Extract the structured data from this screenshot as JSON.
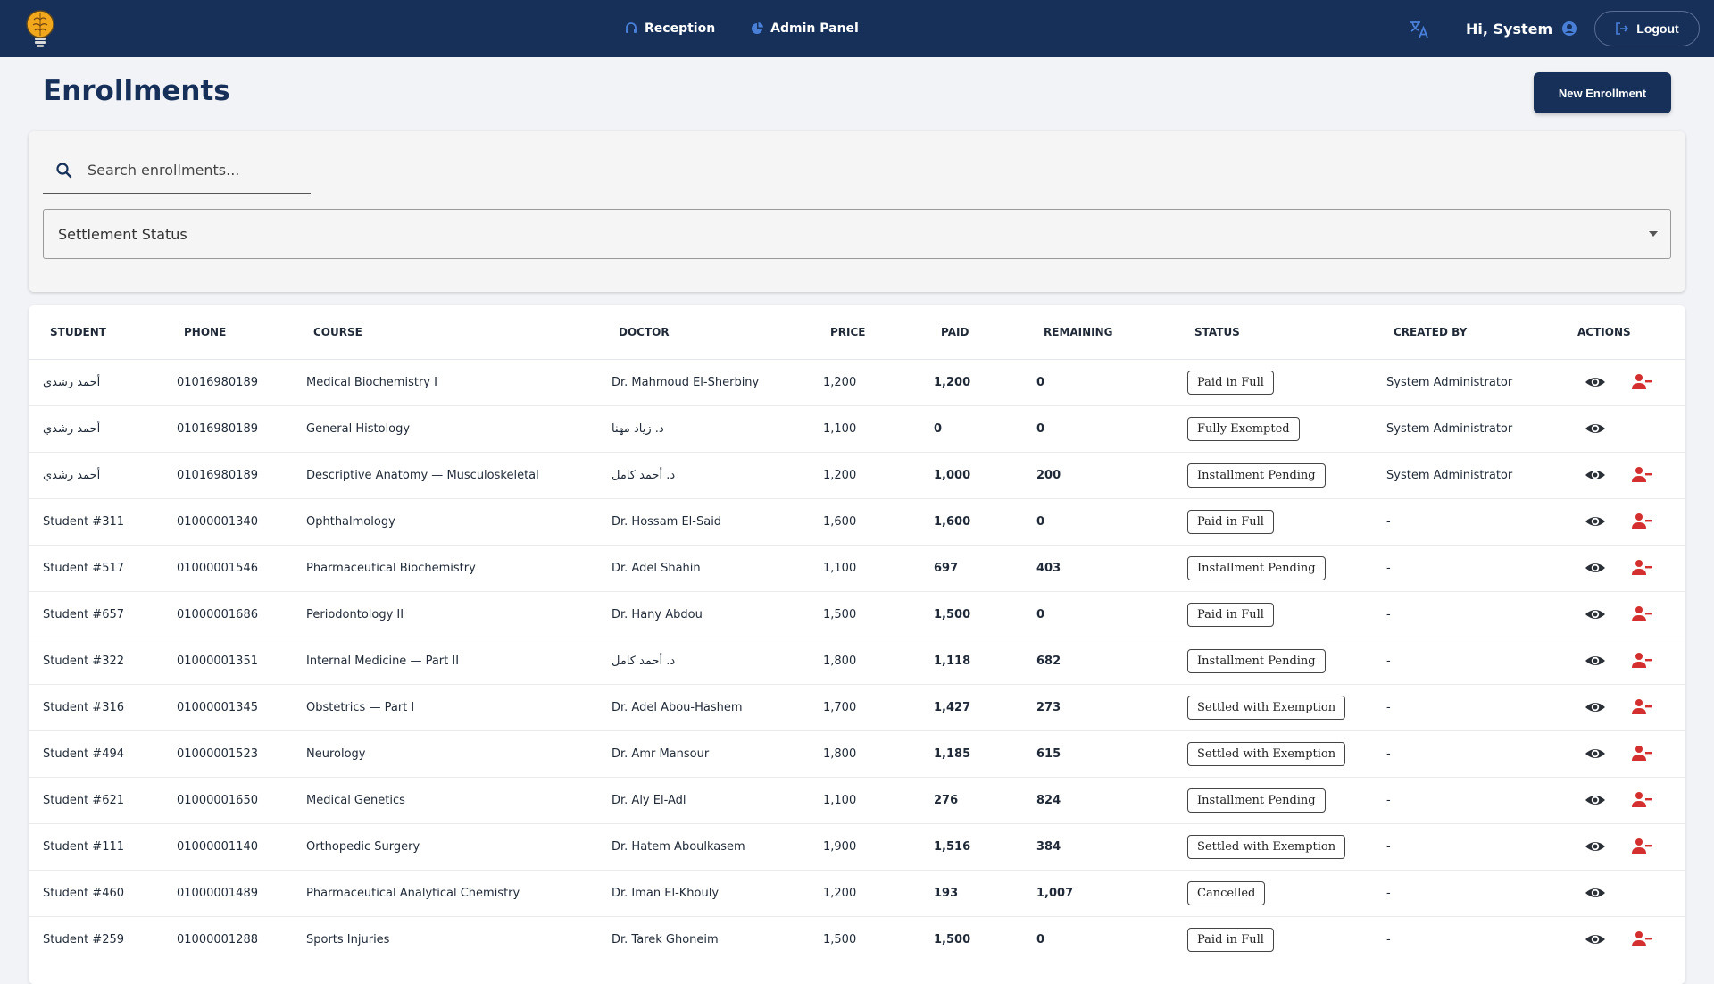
{
  "nav": {
    "reception_label": "Reception",
    "admin_label": "Admin Panel",
    "greeting": "Hi, System",
    "logout_label": "Logout"
  },
  "page": {
    "title": "Enrollments",
    "new_button_label": "New Enrollment"
  },
  "filters": {
    "search_placeholder": "Search enrollments...",
    "settlement_label": "Settlement Status"
  },
  "table": {
    "headers": [
      "STUDENT",
      "PHONE",
      "COURSE",
      "DOCTOR",
      "PRICE",
      "PAID",
      "REMAINING",
      "STATUS",
      "CREATED BY",
      "ACTIONS"
    ],
    "rows": [
      {
        "student": "أحمد رشدي",
        "phone": "01016980189",
        "course": "Medical Biochemistry I",
        "doctor": "Dr. Mahmoud El-Sherbiny",
        "price": "1,200",
        "paid": "1,200",
        "remaining": "0",
        "status": "Paid in Full",
        "created_by": "System Administrator",
        "unenroll": true
      },
      {
        "student": "أحمد رشدي",
        "phone": "01016980189",
        "course": "General Histology",
        "doctor": "د. زياد مهنا",
        "price": "1,100",
        "paid": "0",
        "remaining": "0",
        "status": "Fully Exempted",
        "created_by": "System Administrator",
        "unenroll": false
      },
      {
        "student": "أحمد رشدي",
        "phone": "01016980189",
        "course": "Descriptive Anatomy — Musculoskeletal",
        "doctor": "د. أحمد كامل",
        "price": "1,200",
        "paid": "1,000",
        "remaining": "200",
        "status": "Installment Pending",
        "created_by": "System Administrator",
        "unenroll": true
      },
      {
        "student": "Student #311",
        "phone": "01000001340",
        "course": "Ophthalmology",
        "doctor": "Dr. Hossam El-Said",
        "price": "1,600",
        "paid": "1,600",
        "remaining": "0",
        "status": "Paid in Full",
        "created_by": "-",
        "unenroll": true
      },
      {
        "student": "Student #517",
        "phone": "01000001546",
        "course": "Pharmaceutical Biochemistry",
        "doctor": "Dr. Adel Shahin",
        "price": "1,100",
        "paid": "697",
        "remaining": "403",
        "status": "Installment Pending",
        "created_by": "-",
        "unenroll": true
      },
      {
        "student": "Student #657",
        "phone": "01000001686",
        "course": "Periodontology II",
        "doctor": "Dr. Hany Abdou",
        "price": "1,500",
        "paid": "1,500",
        "remaining": "0",
        "status": "Paid in Full",
        "created_by": "-",
        "unenroll": true
      },
      {
        "student": "Student #322",
        "phone": "01000001351",
        "course": "Internal Medicine — Part II",
        "doctor": "د. أحمد كامل",
        "price": "1,800",
        "paid": "1,118",
        "remaining": "682",
        "status": "Installment Pending",
        "created_by": "-",
        "unenroll": true
      },
      {
        "student": "Student #316",
        "phone": "01000001345",
        "course": "Obstetrics — Part I",
        "doctor": "Dr. Adel Abou-Hashem",
        "price": "1,700",
        "paid": "1,427",
        "remaining": "273",
        "status": "Settled with Exemption",
        "created_by": "-",
        "unenroll": true
      },
      {
        "student": "Student #494",
        "phone": "01000001523",
        "course": "Neurology",
        "doctor": "Dr. Amr Mansour",
        "price": "1,800",
        "paid": "1,185",
        "remaining": "615",
        "status": "Settled with Exemption",
        "created_by": "-",
        "unenroll": true
      },
      {
        "student": "Student #621",
        "phone": "01000001650",
        "course": "Medical Genetics",
        "doctor": "Dr. Aly El-Adl",
        "price": "1,100",
        "paid": "276",
        "remaining": "824",
        "status": "Installment Pending",
        "created_by": "-",
        "unenroll": true
      },
      {
        "student": "Student #111",
        "phone": "01000001140",
        "course": "Orthopedic Surgery",
        "doctor": "Dr. Hatem Aboulkasem",
        "price": "1,900",
        "paid": "1,516",
        "remaining": "384",
        "status": "Settled with Exemption",
        "created_by": "-",
        "unenroll": true
      },
      {
        "student": "Student #460",
        "phone": "01000001489",
        "course": "Pharmaceutical Analytical Chemistry",
        "doctor": "Dr. Iman El-Khouly",
        "price": "1,200",
        "paid": "193",
        "remaining": "1,007",
        "status": "Cancelled",
        "created_by": "-",
        "unenroll": false
      },
      {
        "student": "Student #259",
        "phone": "01000001288",
        "course": "Sports Injuries",
        "doctor": "Dr. Tarek Ghoneim",
        "price": "1,500",
        "paid": "1,500",
        "remaining": "0",
        "status": "Paid in Full",
        "created_by": "-",
        "unenroll": true
      }
    ]
  },
  "colors": {
    "primary": "#16305a",
    "accent_blue": "#4a7fd8",
    "danger_red": "#d32f2f"
  },
  "icons": {
    "logo": "brain-bulb-logo",
    "reception": "headset-icon",
    "admin": "chart-pie-icon",
    "translate": "translate-icon",
    "user": "user-circle-icon",
    "logout": "logout-icon",
    "search": "search-icon",
    "view": "eye-icon",
    "unenroll": "user-minus-icon"
  }
}
